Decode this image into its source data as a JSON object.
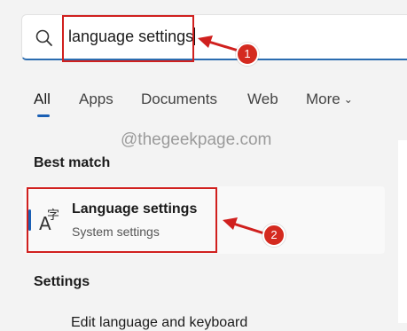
{
  "search": {
    "query": "language settings"
  },
  "tabs": [
    {
      "label": "All"
    },
    {
      "label": "Apps"
    },
    {
      "label": "Documents"
    },
    {
      "label": "Web"
    },
    {
      "label": "More"
    }
  ],
  "watermark": "@thegeekpage.com",
  "best_match": {
    "heading": "Best match",
    "title": "Language settings",
    "subtitle": "System settings"
  },
  "settings": {
    "heading": "Settings",
    "partial_item": "Edit language and keyboard"
  },
  "annotations": {
    "step1": "1",
    "step2": "2"
  },
  "colors": {
    "accent": "#1a5fb4",
    "annotation_red": "#d0201e"
  }
}
